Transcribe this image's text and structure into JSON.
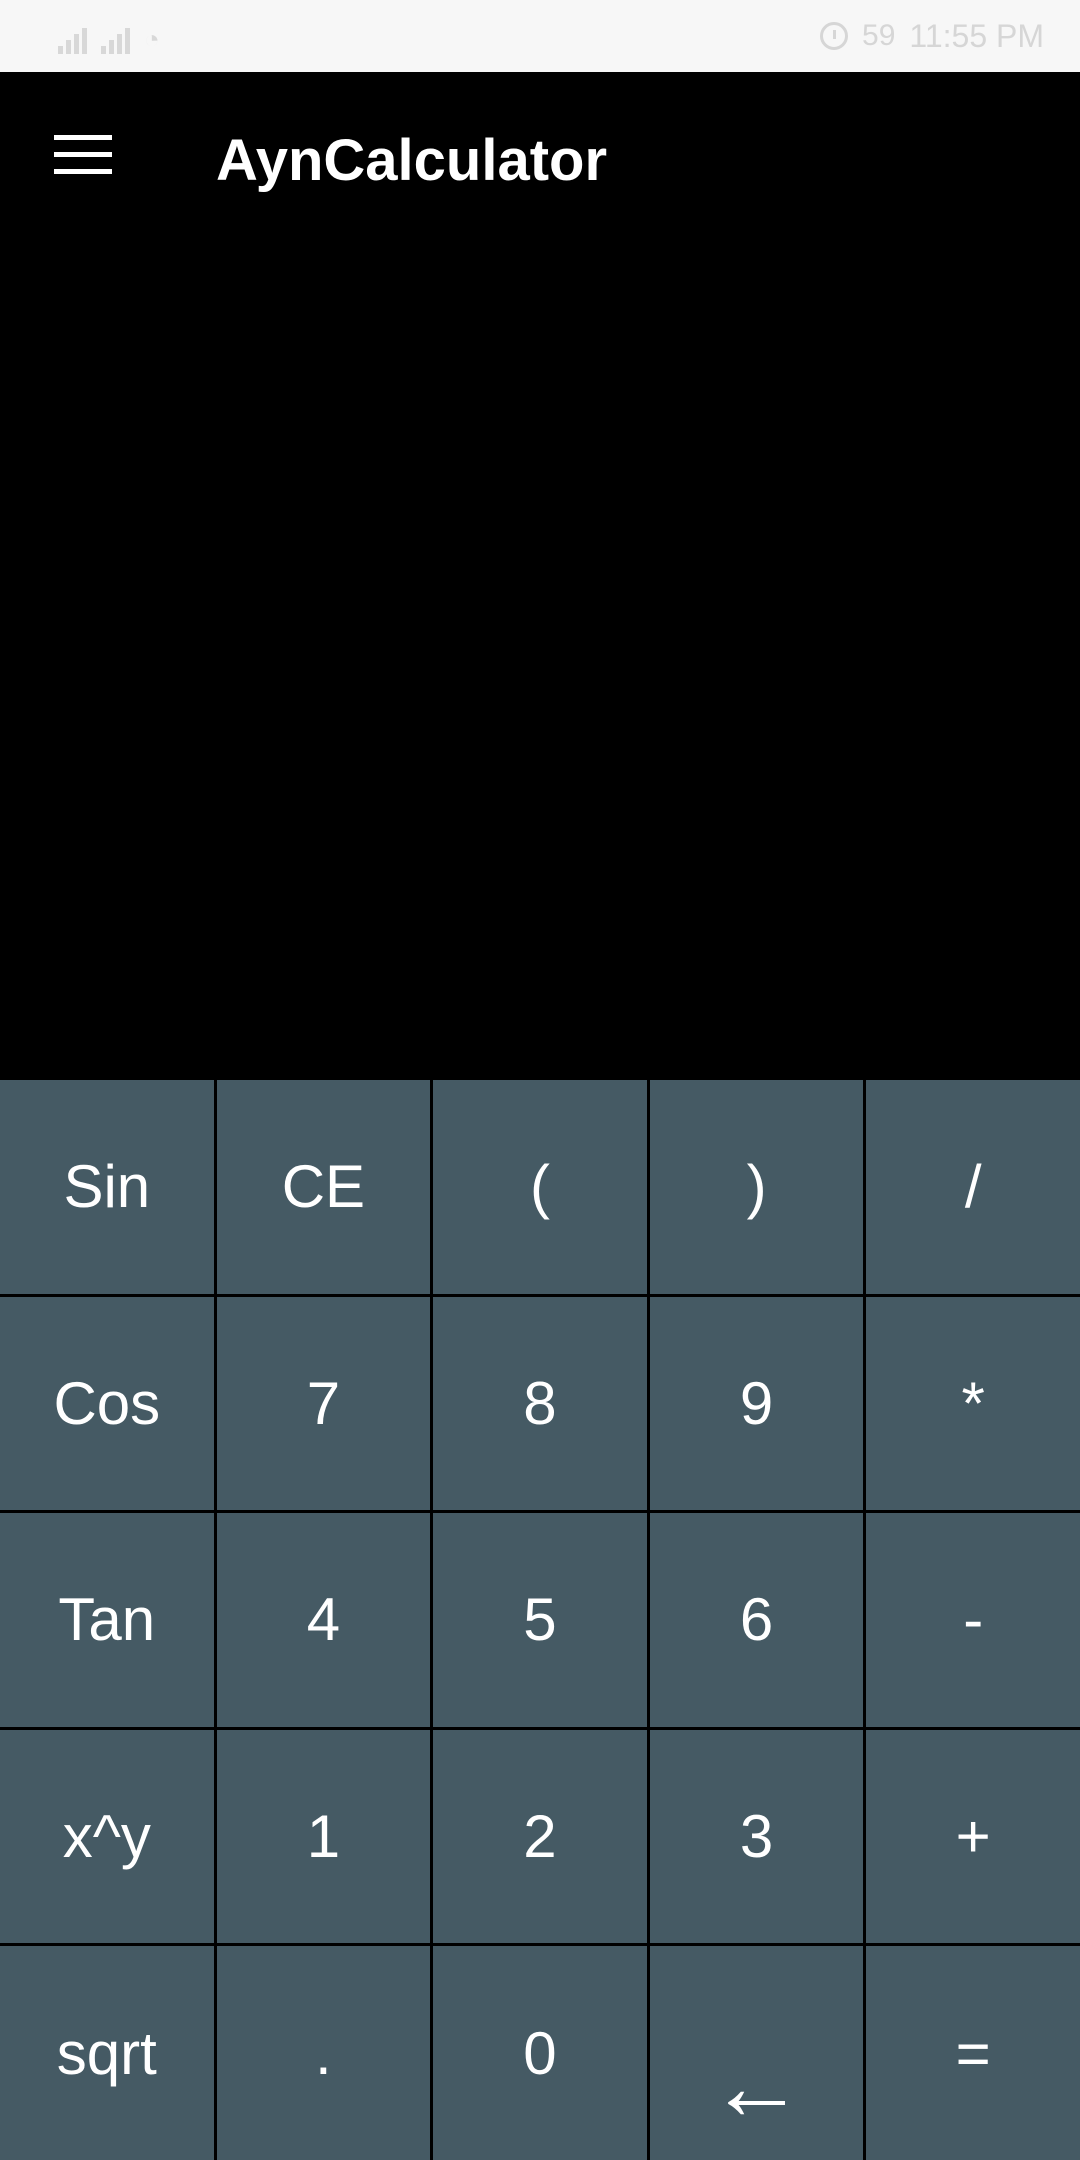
{
  "status_bar": {
    "battery": "59",
    "time": "11:55 PM"
  },
  "app_bar": {
    "title": "AynCalculator"
  },
  "display": {
    "value": ""
  },
  "keypad": {
    "rows": [
      [
        "Sin",
        "CE",
        "(",
        ")",
        "/"
      ],
      [
        "Cos",
        "7",
        "8",
        "9",
        "*"
      ],
      [
        "Tan",
        "4",
        "5",
        "6",
        "-"
      ],
      [
        "x^y",
        "1",
        "2",
        "3",
        "+"
      ],
      [
        "sqrt",
        ".",
        "0",
        "←",
        "="
      ]
    ]
  },
  "colors": {
    "key_background": "#455a64",
    "app_background": "#000000",
    "key_text": "#ffffff"
  }
}
